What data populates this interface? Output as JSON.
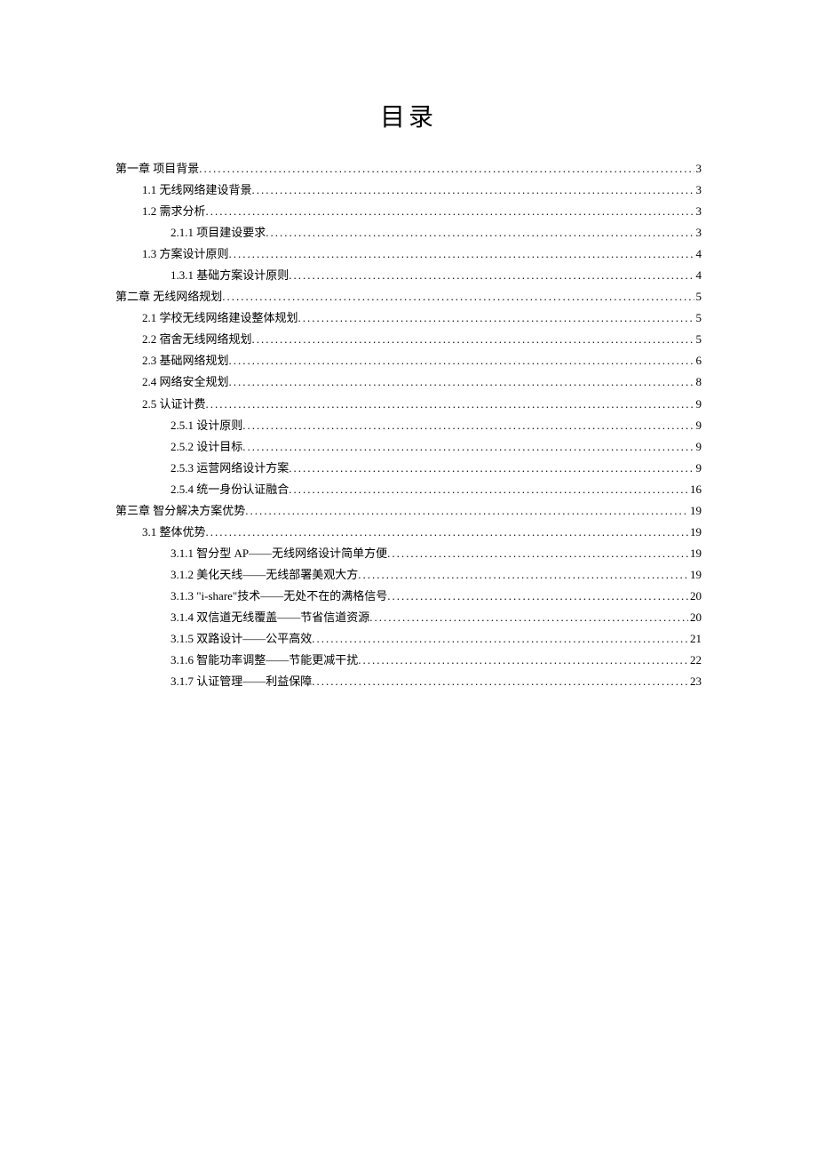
{
  "title": "目录",
  "entries": [
    {
      "level": 0,
      "label": "第一章  项目背景",
      "page": "3"
    },
    {
      "level": 1,
      "label": "1.1 无线网络建设背景",
      "page": "3"
    },
    {
      "level": 1,
      "label": "1.2 需求分析",
      "page": "3"
    },
    {
      "level": 2,
      "label": "2.1.1 项目建设要求",
      "page": "3"
    },
    {
      "level": 1,
      "label": "1.3 方案设计原则",
      "page": "4"
    },
    {
      "level": 2,
      "label": "1.3.1 基础方案设计原则",
      "page": "4"
    },
    {
      "level": 0,
      "label": "第二章 无线网络规划",
      "page": "5"
    },
    {
      "level": 1,
      "label": "2.1 学校无线网络建设整体规划",
      "page": "5"
    },
    {
      "level": 1,
      "label": "2.2 宿舍无线网络规划",
      "page": "5"
    },
    {
      "level": 1,
      "label": "2.3 基础网络规划",
      "page": "6"
    },
    {
      "level": 1,
      "label": "2.4 网络安全规划",
      "page": "8"
    },
    {
      "level": 1,
      "label": "2.5 认证计费",
      "page": "9"
    },
    {
      "level": 2,
      "label": "2.5.1 设计原则",
      "page": "9"
    },
    {
      "level": 2,
      "label": "2.5.2 设计目标",
      "page": "9"
    },
    {
      "level": 2,
      "label": "2.5.3 运营网络设计方案",
      "page": "9"
    },
    {
      "level": 2,
      "label": "2.5.4 统一身份认证融合",
      "page": "16"
    },
    {
      "level": 0,
      "label": "第三章 智分解决方案优势",
      "page": "19"
    },
    {
      "level": 1,
      "label": "3.1 整体优势",
      "page": "19"
    },
    {
      "level": 2,
      "label": "3.1.1 智分型 AP——无线网络设计简单方便",
      "page": "19"
    },
    {
      "level": 2,
      "label": "3.1.2 美化天线——无线部署美观大方",
      "page": "19"
    },
    {
      "level": 2,
      "label": "3.1.3 \"i-share\"技术——无处不在的满格信号",
      "page": "20"
    },
    {
      "level": 2,
      "label": "3.1.4 双信道无线覆盖——节省信道资源",
      "page": "20"
    },
    {
      "level": 2,
      "label": "3.1.5 双路设计——公平高效",
      "page": "21"
    },
    {
      "level": 2,
      "label": "3.1.6 智能功率调整——节能更减干扰",
      "page": "22"
    },
    {
      "level": 2,
      "label": "3.1.7 认证管理——利益保障",
      "page": "23"
    }
  ]
}
